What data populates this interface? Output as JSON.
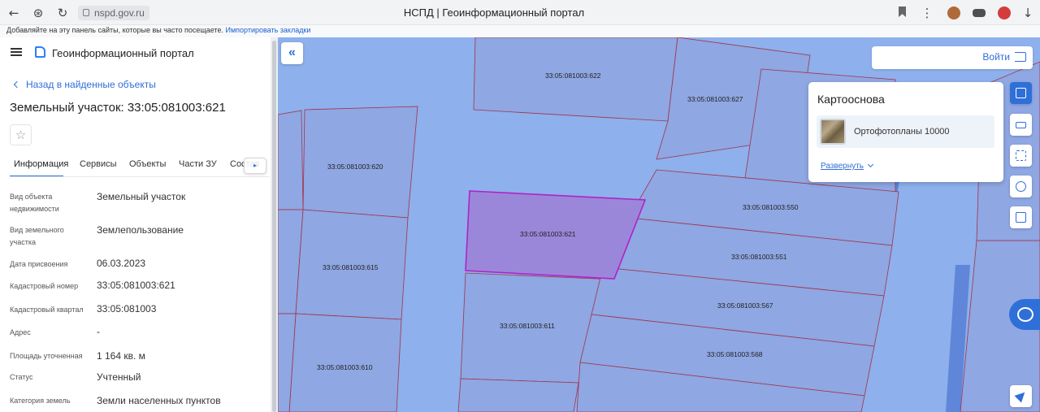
{
  "browser": {
    "url": "nspd.gov.ru",
    "tab_title": "НСПД | Геоинформационный портал",
    "bookmarks_prompt": "Добавляйте на эту панель сайты, которые вы часто посещаете.",
    "bookmarks_import": "Импортировать закладки"
  },
  "header": {
    "app_title": "Геоинформационный портал"
  },
  "panel": {
    "back_label": "Назад в найденные объекты",
    "object_title": "Земельный участок: 33:05:081003:621",
    "tabs": [
      "Информация",
      "Сервисы",
      "Объекты",
      "Части ЗУ",
      "Состав"
    ],
    "properties": [
      {
        "label": "Вид объекта недвижимости",
        "value": "Земельный участок"
      },
      {
        "label": "Вид земельного участка",
        "value": "Землепользование"
      },
      {
        "label": "Дата присвоения",
        "value": "06.03.2023"
      },
      {
        "label": "Кадастровый номер",
        "value": "33:05:081003:621"
      },
      {
        "label": "Кадастровый квартал",
        "value": "33:05:081003"
      },
      {
        "label": "Адрес",
        "value": "-"
      },
      {
        "label": "Площадь уточненная",
        "value": "1 164 кв. м"
      },
      {
        "label": "Статус",
        "value": "Учтенный"
      },
      {
        "label": "Категория земель",
        "value": "Земли населенных пунктов"
      }
    ]
  },
  "map": {
    "parcels": [
      "33:05:081003:622",
      "33:05:081003:627",
      "33:05:081003:620",
      "33:05:081003:550",
      "33:05:081003:621",
      "33:05:081003:615",
      "33:05:081003:551",
      "33:05:081003:567",
      "33:05:081003:611",
      "33:05:081003:568",
      "33:05:081003:610"
    ],
    "login_label": "Войти",
    "basemap": {
      "title": "Картооснова",
      "layer_name": "Ортофотопланы 10000",
      "expand_label": "Развернуть"
    }
  },
  "icons": {
    "back": "arrow-left-icon",
    "forward": "arrow-right-icon",
    "reload": "reload-icon",
    "collapse": "double-chevron-left-icon",
    "login": "login-icon",
    "layers": "layers-icon",
    "ruler": "ruler-icon",
    "select": "select-area-icon",
    "share": "share-icon",
    "print": "print-icon",
    "chat": "chat-icon",
    "locate": "locate-icon"
  },
  "colors": {
    "accent": "#2f6fd8",
    "map_water": "#8eb0ec",
    "parcel_fill": "#8fa7e3",
    "selected_parcel": "#a36ed3",
    "parcel_border": "#a0334a"
  }
}
